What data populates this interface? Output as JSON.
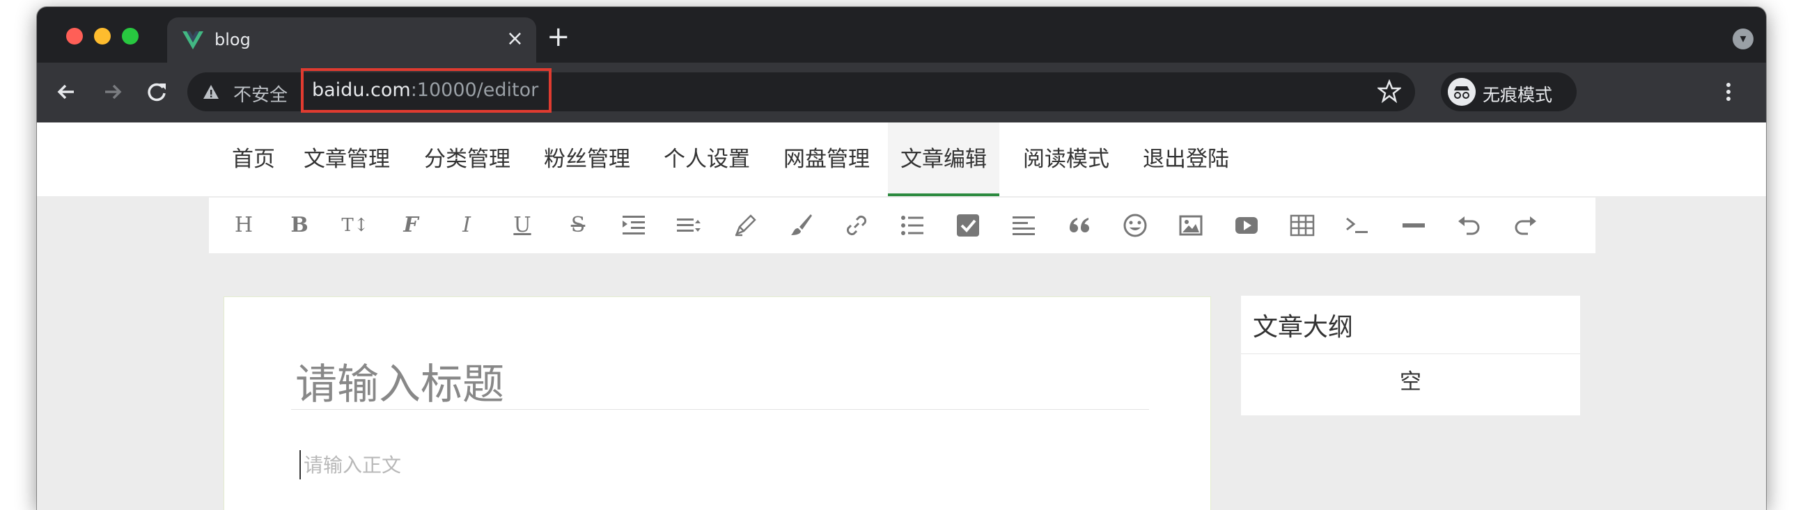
{
  "browser": {
    "tab_title": "blog",
    "tab_close": "×",
    "new_tab": "+",
    "security_label": "不安全",
    "url_host": "baidu.com",
    "url_rest": ":10000/editor",
    "incognito_label": "无痕模式",
    "icons": [
      "back-icon",
      "forward-icon",
      "reload-icon",
      "warning-icon",
      "star-icon",
      "incognito-icon",
      "more-icon",
      "vue-logo-icon"
    ]
  },
  "nav": {
    "items": [
      "首页",
      "文章管理",
      "分类管理",
      "粉丝管理",
      "个人设置",
      "网盘管理",
      "文章编辑",
      "阅读模式",
      "退出登陆"
    ],
    "active": "文章编辑",
    "accent_color": "#2c8a3f"
  },
  "editor_toolbar": {
    "heading_glyph": "H",
    "bold_glyph": "B",
    "text_size_glyph": "T↕",
    "font_glyph": "F",
    "italic_glyph": "I",
    "underline_glyph": "U",
    "strike_glyph": "S",
    "icons": [
      "heading-icon",
      "bold-icon",
      "text-size-icon",
      "font-icon",
      "italic-icon",
      "underline-icon",
      "strikethrough-icon",
      "indent-icon",
      "line-height-icon",
      "pen-icon",
      "brush-icon",
      "link-icon",
      "bullet-list-icon",
      "checkbox-icon",
      "align-left-icon",
      "quote-icon",
      "emoji-icon",
      "image-icon",
      "video-icon",
      "table-icon",
      "code-icon",
      "divider-icon",
      "undo-icon",
      "redo-icon"
    ]
  },
  "editor": {
    "title_placeholder": "请输入标题",
    "body_placeholder": "请输入正文"
  },
  "outline": {
    "title": "文章大纲",
    "empty_text": "空"
  }
}
